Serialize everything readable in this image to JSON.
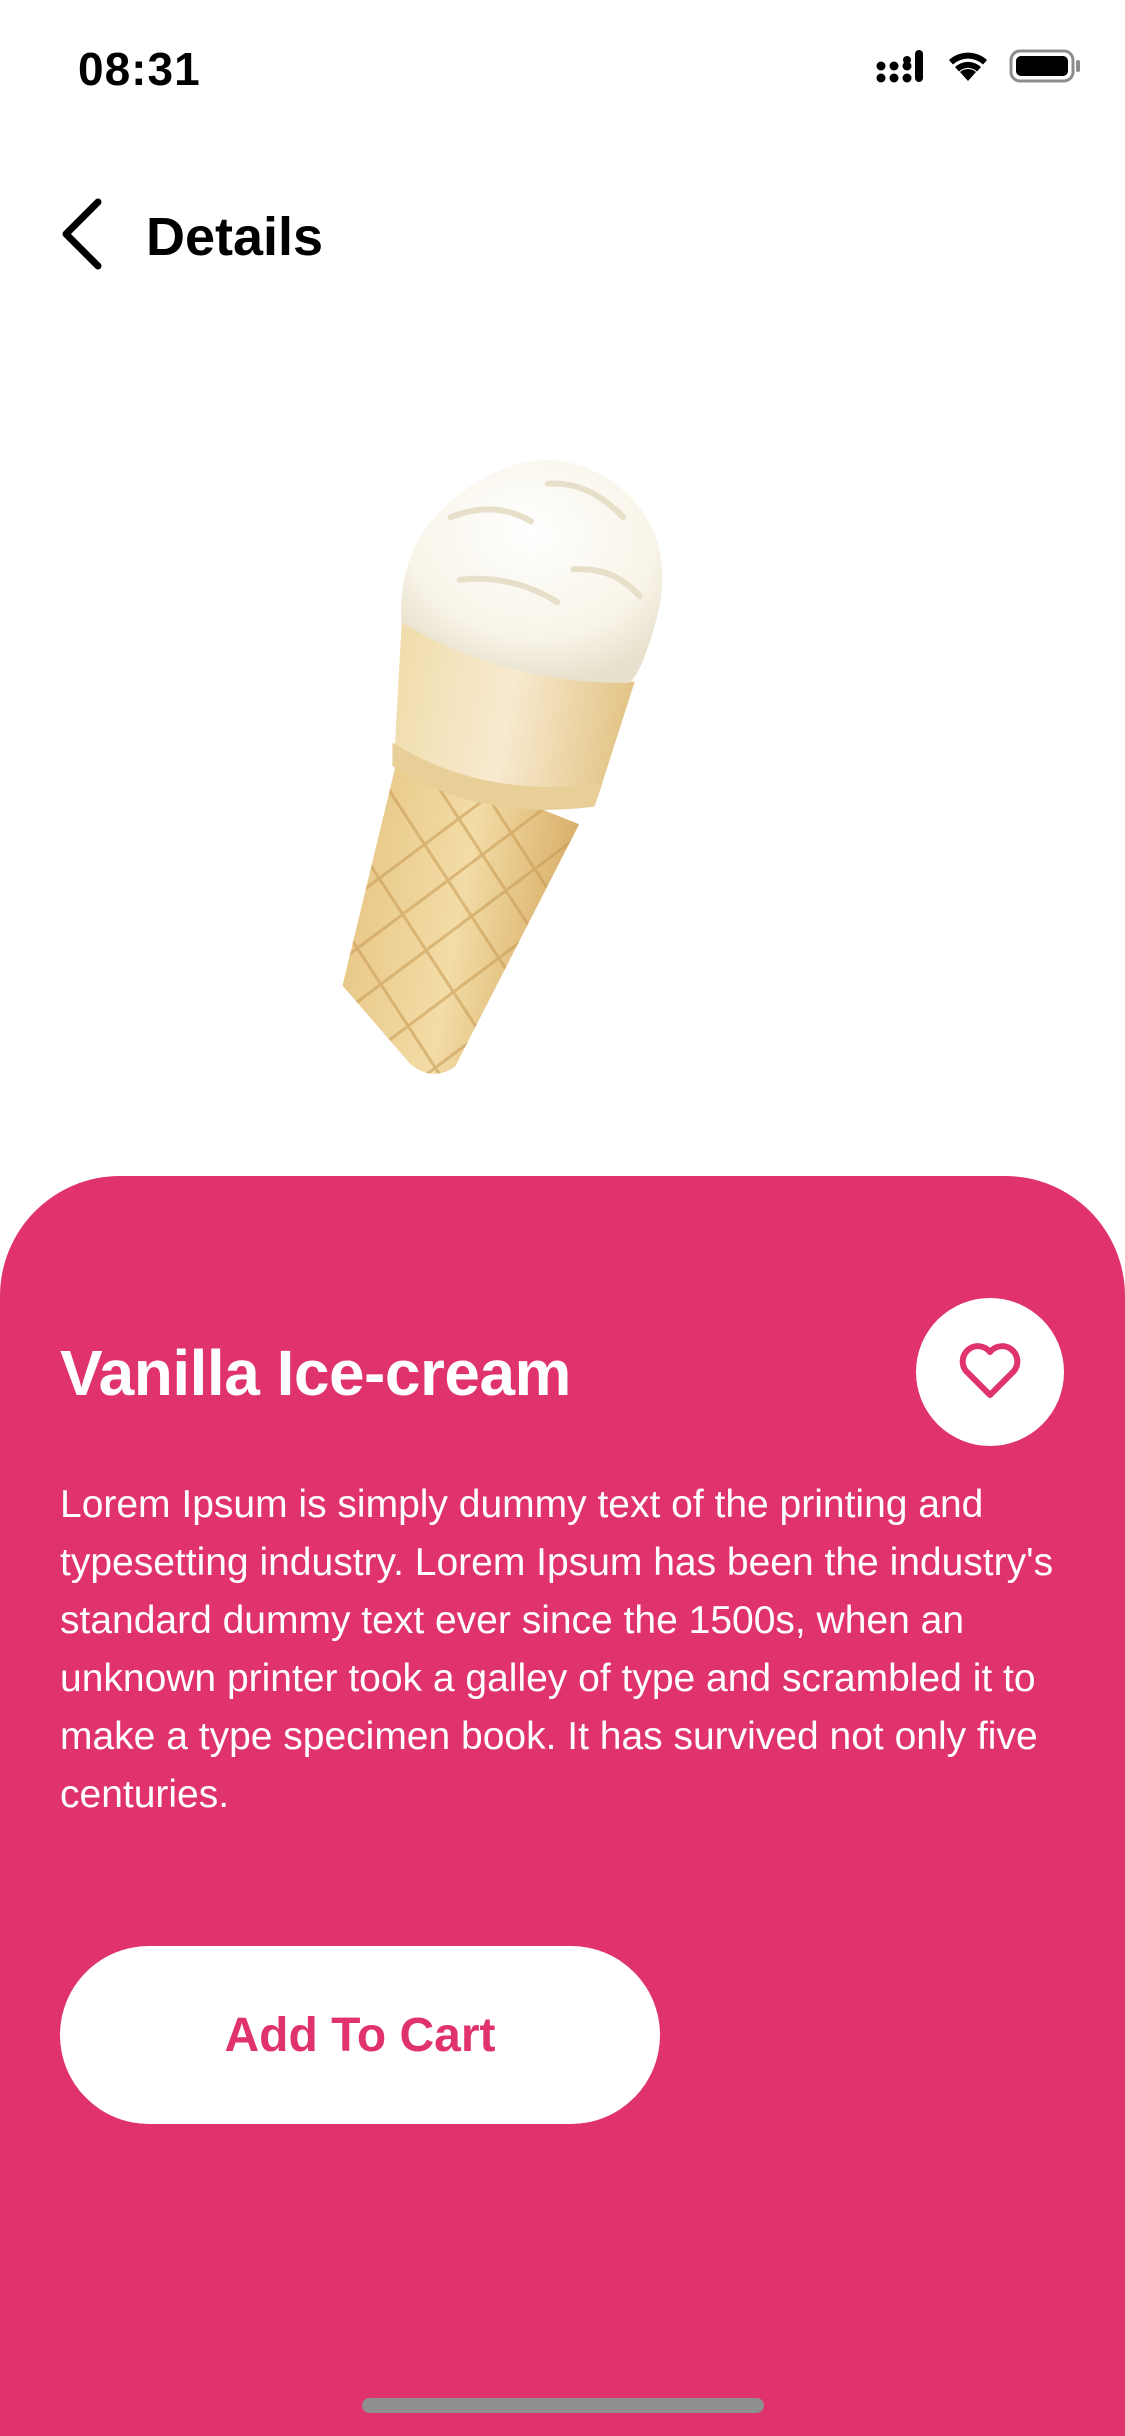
{
  "status_bar": {
    "time": "08:31",
    "icons": [
      "cellular-signal-icon",
      "wifi-icon",
      "battery-icon"
    ]
  },
  "header": {
    "title": "Details",
    "back_icon": "chevron-left-icon"
  },
  "product": {
    "image": "ice-cream-cone",
    "name": "Vanilla Ice-cream",
    "favorite_icon": "heart-outline-icon",
    "description": "Lorem Ipsum is simply dummy text of the printing and typesetting industry. Lorem Ipsum has been the industry's standard dummy text ever since the 1500s, when an unknown printer took a galley of type and scrambled it to make a type specimen book. It has survived not only five centuries.",
    "add_to_cart_label": "Add To Cart"
  },
  "colors": {
    "accent": "#e0336b",
    "background": "#ffffff",
    "card_text": "#ffffff"
  }
}
